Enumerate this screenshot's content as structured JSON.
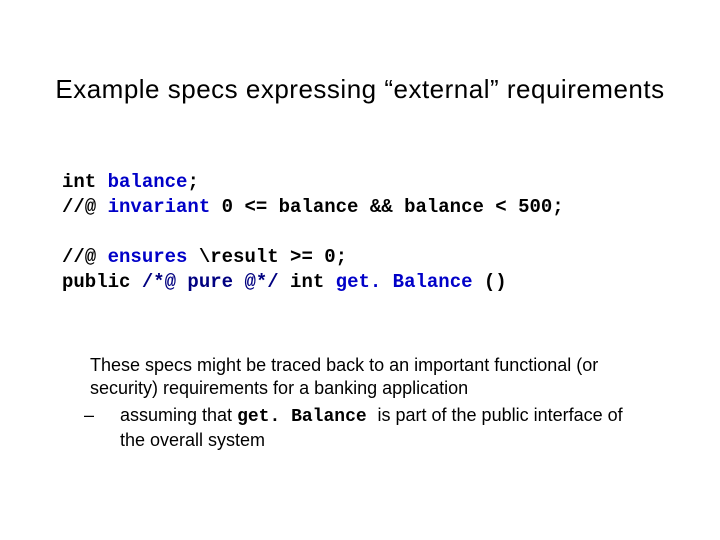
{
  "title": "Example specs expressing “external” requirements",
  "code": {
    "l1a": "int ",
    "l1b": "balance",
    "l1c": ";",
    "l2a": "//@ ",
    "l2b": "invariant",
    "l2c": " 0 <= balance && balance < 500;",
    "l3a": "//@ ",
    "l3b": "ensures",
    "l3c": " \\result >= 0;",
    "l4a": "public ",
    "l4b": "/*@ pure @*/",
    "l4c": " int ",
    "l4d": "get. Balance",
    "l4e": " ()"
  },
  "explain": {
    "p1": "These specs might be traced back to an important functional (or security) requirements for a banking application",
    "p2a": "assuming that ",
    "p2b": "get. Balance ",
    "p2c": " is part of the public interface of the overall system"
  }
}
